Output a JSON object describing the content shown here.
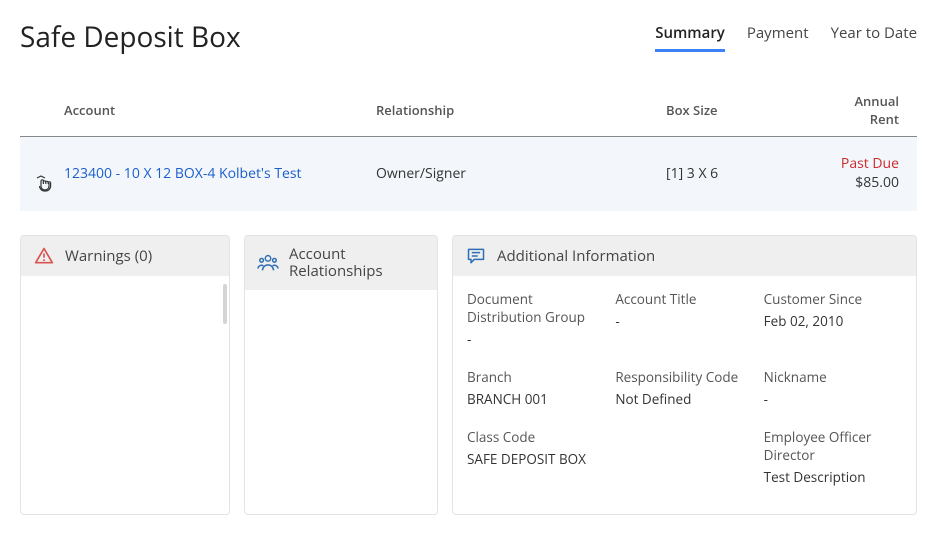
{
  "header": {
    "title": "Safe Deposit Box"
  },
  "tabs": {
    "summary": "Summary",
    "payment": "Payment",
    "ytd": "Year to Date"
  },
  "table": {
    "headers": {
      "account": "Account",
      "relationship": "Relationship",
      "boxsize": "Box Size",
      "rent": "Annual Rent"
    },
    "row": {
      "account": "123400 - 10 X 12 BOX-4 Kolbet's Test",
      "relationship": "Owner/Signer",
      "boxsize": "[1] 3 X 6",
      "past_due": "Past Due",
      "amount": "$85.00"
    }
  },
  "panels": {
    "warnings_title": "Warnings (0)",
    "relationships_title_1": "Account",
    "relationships_title_2": "Relationships",
    "additional_title": "Additional Information",
    "info": {
      "doc_dist_label": "Document Distribution Group",
      "doc_dist_value": "-",
      "acct_title_label": "Account Title",
      "acct_title_value": "-",
      "cust_since_label": "Customer Since",
      "cust_since_value": "Feb 02, 2010",
      "branch_label": "Branch",
      "branch_value": "BRANCH 001",
      "resp_code_label": "Responsibility Code",
      "resp_code_value": "Not Defined",
      "nickname_label": "Nickname",
      "nickname_value": "-",
      "class_code_label": "Class Code",
      "class_code_value": "SAFE DEPOSIT BOX",
      "eod_label": "Employee Officer Director",
      "eod_value": "Test Description"
    }
  }
}
